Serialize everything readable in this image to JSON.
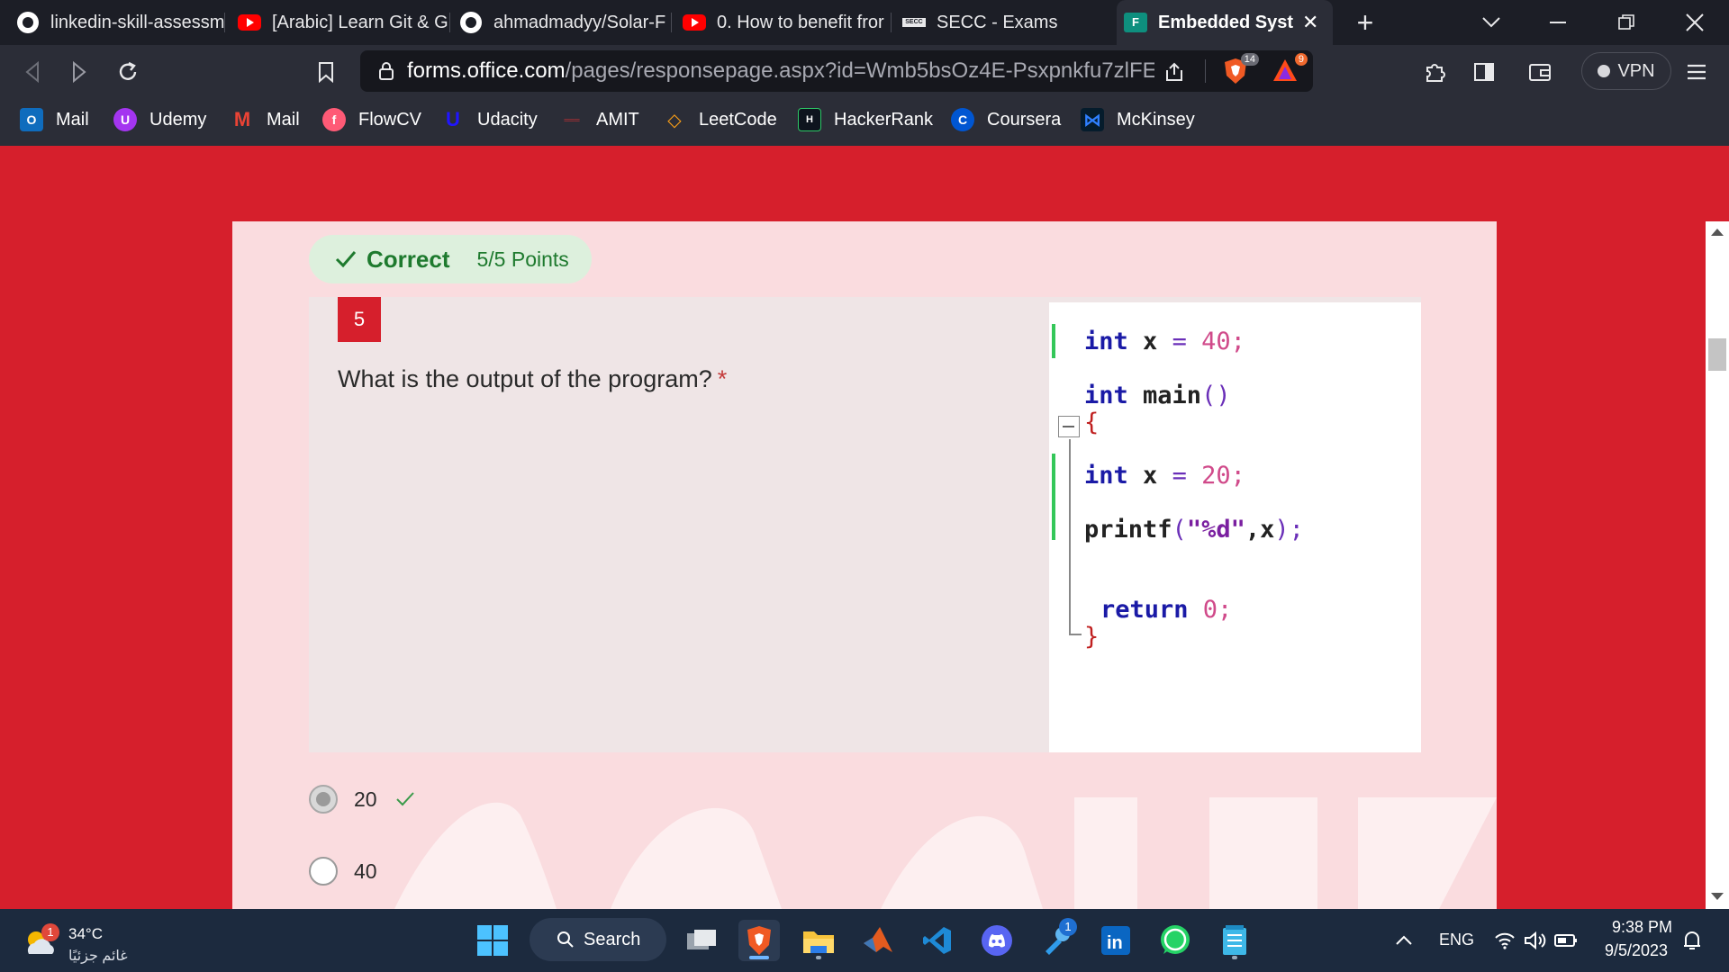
{
  "browser": {
    "tabs": [
      {
        "title": "linkedin-skill-assessm",
        "icon": "github-icon"
      },
      {
        "title": "[Arabic] Learn Git & G",
        "icon": "youtube-icon"
      },
      {
        "title": "ahmadmadyy/Solar-F",
        "icon": "github-icon"
      },
      {
        "title": "0. How to benefit fror",
        "icon": "youtube-icon"
      },
      {
        "title": "SECC - Exams",
        "icon": "secc-icon"
      },
      {
        "title": "Embedded Syste",
        "icon": "microsoft-forms-icon",
        "active": true
      }
    ],
    "new_tab_label": "+",
    "address": {
      "host": "forms.office.com",
      "path": "/pages/responsepage.aspx?id=Wmb5bsOz4E-Psxpnkfu7zlFEP..."
    },
    "brave_shield_count": "14",
    "rewards_count": "9",
    "vpn_label": "VPN",
    "bookmarks": [
      {
        "label": "Mail",
        "icon": "outlook-icon"
      },
      {
        "label": "Udemy",
        "icon": "udemy-icon"
      },
      {
        "label": "Mail",
        "icon": "gmail-icon"
      },
      {
        "label": "FlowCV",
        "icon": "flowcv-icon"
      },
      {
        "label": "Udacity",
        "icon": "udacity-icon"
      },
      {
        "label": "AMIT",
        "icon": "amit-icon"
      },
      {
        "label": "LeetCode",
        "icon": "leetcode-icon"
      },
      {
        "label": "HackerRank",
        "icon": "hackerrank-icon"
      },
      {
        "label": "Coursera",
        "icon": "coursera-icon"
      },
      {
        "label": "McKinsey",
        "icon": "mckinsey-icon"
      }
    ]
  },
  "form": {
    "result_label": "Correct",
    "points": "5/5 Points",
    "question_number": "5",
    "question_text": "What is the output of the program?",
    "required_mark": "*",
    "code_image": {
      "line1_kw": "int",
      "line1_rest": " x ",
      "line1_op": "=",
      "line1_num": " 40;",
      "line2_kw": "int",
      "line2_rest": " main",
      "line2_paren": "()",
      "line3_brace": "{",
      "line4_kw": "int",
      "line4_rest": " x ",
      "line4_op": "=",
      "line4_num": " 20;",
      "line5_fn": "printf",
      "line5_paren": "(",
      "line5_str": "\"%d\"",
      "line5_rest": ",x",
      "line5_end": ");",
      "line6_kw": "return",
      "line6_num": " 0;",
      "line7_brace": "}"
    },
    "options": [
      {
        "label": "20",
        "selected": true,
        "correct": true
      },
      {
        "label": "40",
        "selected": false
      }
    ]
  },
  "taskbar": {
    "weather_temp": "34°C",
    "weather_desc": "غائم جزئيًا",
    "weather_badge": "1",
    "search_label": "Search",
    "pinned_badge": "1",
    "language": "ENG",
    "time": "9:38 PM",
    "date": "9/5/2023"
  },
  "colors": {
    "accent": "#d61f2c",
    "card": "#fadcdf",
    "correct_green": "#1e7a2e"
  }
}
